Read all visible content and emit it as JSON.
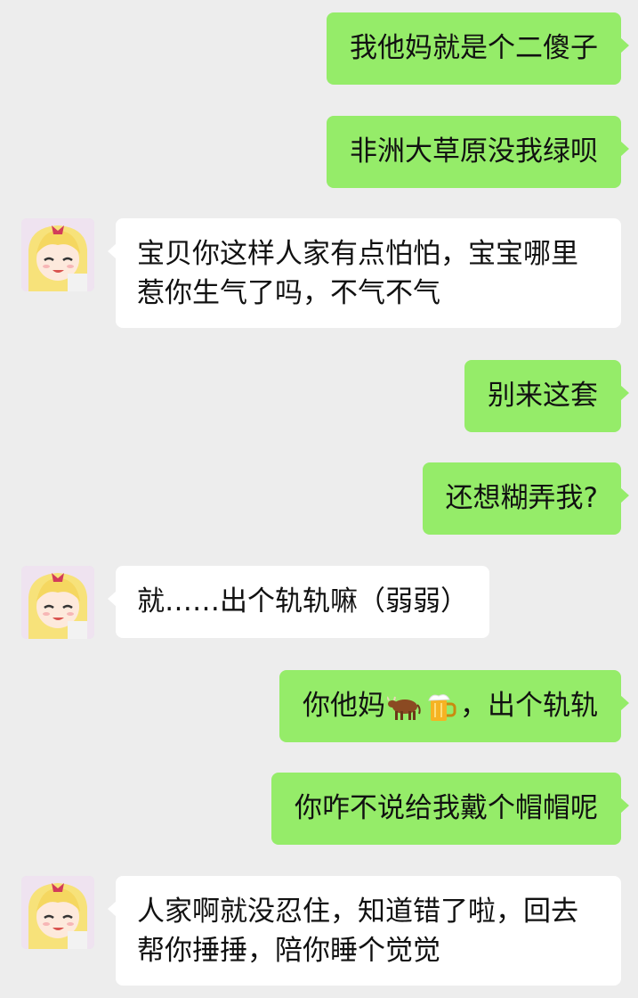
{
  "messages": [
    {
      "side": "out",
      "text": "我他妈就是个二傻子"
    },
    {
      "side": "out",
      "text": "非洲大草原没我绿呗"
    },
    {
      "side": "in",
      "text": "宝贝你这样人家有点怕怕，宝宝哪里惹你生气了吗，不气不气"
    },
    {
      "side": "out",
      "text": "别来这套"
    },
    {
      "side": "out",
      "text": "还想糊弄我?"
    },
    {
      "side": "in",
      "text": "就……出个轨轨嘛（弱弱）"
    },
    {
      "side": "out",
      "text_before": "你他妈",
      "emoji": [
        "cow-icon",
        "beer-mug-icon"
      ],
      "text_after": "，出个轨轨"
    },
    {
      "side": "out",
      "text": "你咋不说给我戴个帽帽呢"
    },
    {
      "side": "in",
      "text": "人家啊就没忍住，知道错了啦，回去帮你捶捶，陪你睡个觉觉"
    }
  ],
  "avatar": {
    "icon": "anime-girl-avatar-icon"
  },
  "colors": {
    "outgoing": "#95ec69",
    "incoming": "#ffffff",
    "background": "#ededed"
  }
}
